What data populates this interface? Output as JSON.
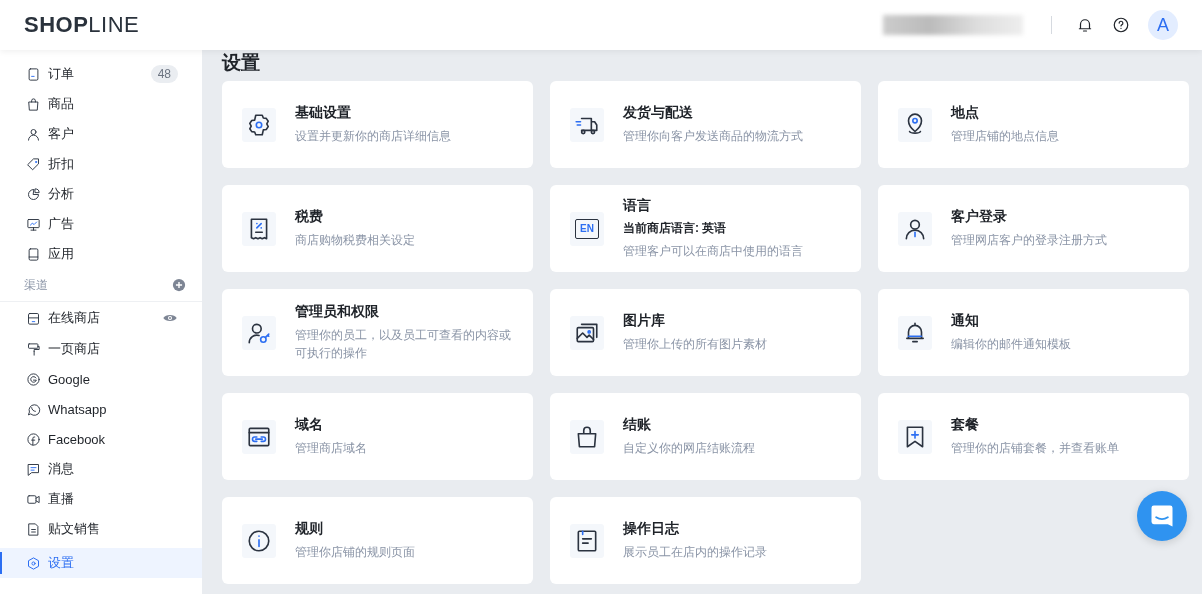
{
  "header": {
    "logo": "**SHOP**LINE",
    "avatar": "A"
  },
  "sidebar": {
    "items": [
      {
        "label": "订单",
        "badge": "48",
        "selected": false
      },
      {
        "label": "商品",
        "selected": false
      },
      {
        "label": "客户",
        "selected": false
      },
      {
        "label": "折扣",
        "selected": false
      },
      {
        "label": "分析",
        "selected": false
      },
      {
        "label": "广告",
        "selected": false
      },
      {
        "label": "应用",
        "selected": false
      }
    ],
    "channels_title": "渠道",
    "channels": [
      {
        "label": "在线商店",
        "selected": false
      },
      {
        "label": "一页商店",
        "selected": false
      },
      {
        "label": "Google",
        "selected": false
      },
      {
        "label": "Whatsapp",
        "selected": false
      },
      {
        "label": "Facebook",
        "selected": false
      },
      {
        "label": "消息",
        "selected": false
      },
      {
        "label": "直播",
        "selected": false
      },
      {
        "label": "贴文销售",
        "selected": false
      }
    ],
    "settings_item": {
      "label": "设置",
      "selected": true
    }
  },
  "page_title": "设置",
  "cards": [
    {
      "title": "基础设置",
      "description": "设置并更新你的商店详细信息"
    },
    {
      "title": "发货与配送",
      "description": "管理你向客户发送商品的物流方式"
    },
    {
      "title": "地点",
      "description": "管理店铺的地点信息"
    },
    {
      "title": "税费",
      "description": "商店购物税费相关设定"
    },
    {
      "title": "语言",
      "icon_text": "EN",
      "subtitle": "当前商店语言: 英语",
      "description": "管理客户可以在商店中使用的语言"
    },
    {
      "title": "客户登录",
      "description": "管理网店客户的登录注册方式"
    },
    {
      "title": "管理员和权限",
      "description": "管理你的员工，以及员工可查看的内容或可执行的操作"
    },
    {
      "title": "图片库",
      "description": "管理你上传的所有图片素材"
    },
    {
      "title": "通知",
      "description": "编辑你的邮件通知模板"
    },
    {
      "title": "域名",
      "description": "管理商店域名"
    },
    {
      "title": "结账",
      "description": "自定义你的网店结账流程"
    },
    {
      "title": "套餐",
      "description": "管理你的店铺套餐，并查看账单"
    },
    {
      "title": "规则",
      "description": "管理你店铺的规则页面"
    },
    {
      "title": "操作日志",
      "description": "展示员工在店内的操作记录"
    }
  ]
}
